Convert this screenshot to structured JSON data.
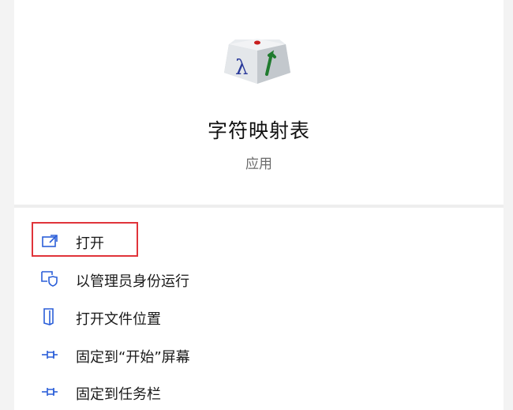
{
  "app": {
    "name": "字符映射表",
    "type": "应用",
    "icon": "character-map-icon"
  },
  "actions": [
    {
      "label": "打开",
      "icon": "open-icon"
    },
    {
      "label": "以管理员身份运行",
      "icon": "shield-run-as-admin-icon"
    },
    {
      "label": "打开文件位置",
      "icon": "file-location-icon"
    },
    {
      "label": "固定到“开始”屏幕",
      "icon": "pin-start-icon"
    },
    {
      "label": "固定到任务栏",
      "icon": "pin-taskbar-icon"
    }
  ],
  "colors": {
    "accent": "#2b5fd9",
    "highlight_border": "#e0343a"
  }
}
